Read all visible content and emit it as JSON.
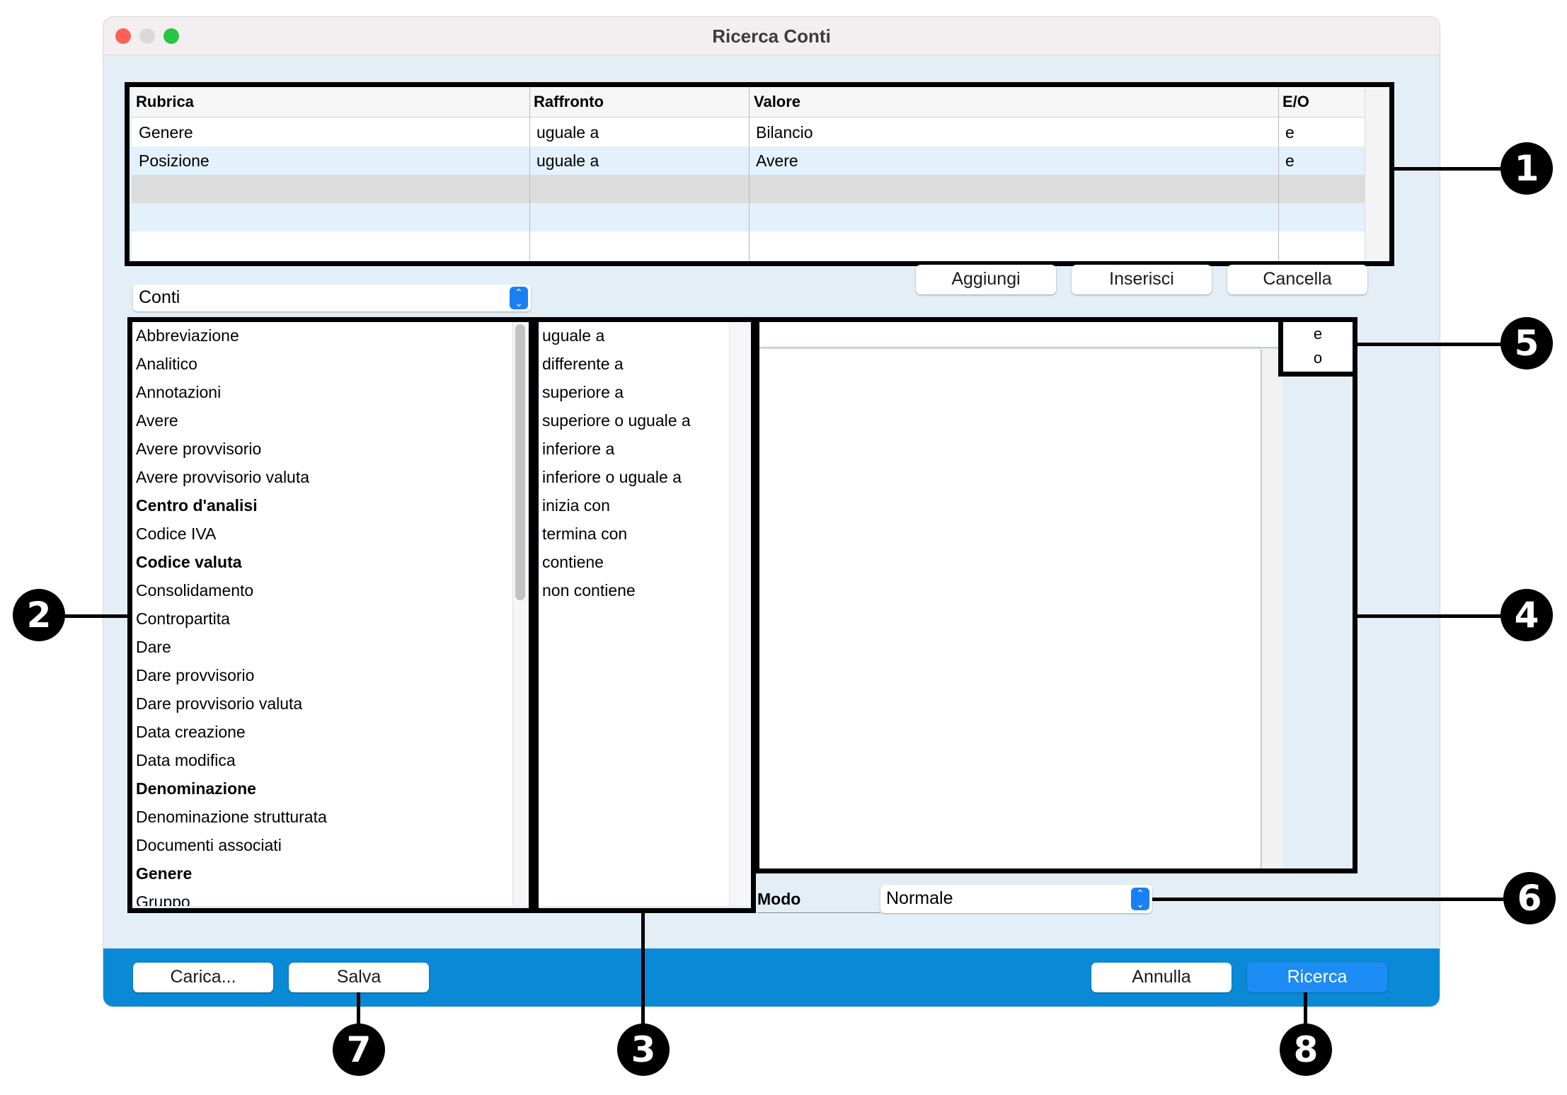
{
  "window": {
    "title": "Ricerca Conti",
    "traffic_lights": [
      "close",
      "minimize",
      "zoom"
    ]
  },
  "criteria_table": {
    "headers": [
      "Rubrica",
      "Raffronto",
      "Valore",
      "E/O"
    ],
    "rows": [
      [
        "Genere",
        "uguale a",
        "Bilancio",
        "e"
      ],
      [
        "Posizione",
        "uguale a",
        "Avere",
        "e"
      ]
    ]
  },
  "criteria_buttons": {
    "add": "Aggiungi",
    "insert": "Inserisci",
    "delete": "Cancella"
  },
  "table_select": {
    "value": "Conti"
  },
  "fields": [
    {
      "label": "Abbreviazione",
      "bold": false
    },
    {
      "label": "Analitico",
      "bold": false
    },
    {
      "label": "Annotazioni",
      "bold": false
    },
    {
      "label": "Avere",
      "bold": false
    },
    {
      "label": "Avere provvisorio",
      "bold": false
    },
    {
      "label": "Avere provvisorio valuta",
      "bold": false
    },
    {
      "label": "Centro d'analisi",
      "bold": true
    },
    {
      "label": "Codice IVA",
      "bold": false
    },
    {
      "label": "Codice valuta",
      "bold": true
    },
    {
      "label": "Consolidamento",
      "bold": false
    },
    {
      "label": "Contropartita",
      "bold": false
    },
    {
      "label": "Dare",
      "bold": false
    },
    {
      "label": "Dare provvisorio",
      "bold": false
    },
    {
      "label": "Dare provvisorio valuta",
      "bold": false
    },
    {
      "label": "Data creazione",
      "bold": false
    },
    {
      "label": "Data modifica",
      "bold": false
    },
    {
      "label": "Denominazione",
      "bold": true
    },
    {
      "label": "Denominazione strutturata",
      "bold": false
    },
    {
      "label": "Documenti associati",
      "bold": false
    },
    {
      "label": "Genere",
      "bold": true
    },
    {
      "label": "Gruppo",
      "bold": false
    }
  ],
  "comparators": [
    "uguale a",
    "differente a",
    "superiore a",
    "superiore o uguale a",
    "inferiore a",
    "inferiore o uguale a",
    "inizia con",
    "termina con",
    "contiene",
    "non contiene"
  ],
  "value_input": {
    "value": ""
  },
  "conjunctions": [
    "e",
    "o"
  ],
  "mode": {
    "label": "Modo",
    "value": "Normale"
  },
  "footer": {
    "load": "Carica...",
    "save": "Salva",
    "cancel": "Annulla",
    "search": "Ricerca"
  },
  "callouts": [
    "1",
    "2",
    "3",
    "4",
    "5",
    "6",
    "7",
    "8"
  ],
  "colors": {
    "window_bg": "#e4eef7",
    "footer_bar": "#0a8ad6",
    "primary_button": "#1d8cf5",
    "row_highlight": "#e3f1fc",
    "row_selected_gray": "#dcdcdc"
  }
}
